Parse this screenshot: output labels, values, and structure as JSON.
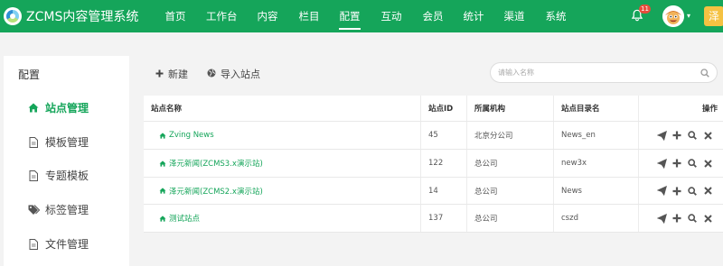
{
  "app": {
    "title": "ZCMS内容管理系统"
  },
  "nav": {
    "items": [
      {
        "label": "首页",
        "active": false
      },
      {
        "label": "工作台",
        "active": false
      },
      {
        "label": "内容",
        "active": false
      },
      {
        "label": "栏目",
        "active": false
      },
      {
        "label": "配置",
        "active": true
      },
      {
        "label": "互动",
        "active": false
      },
      {
        "label": "会员",
        "active": false
      },
      {
        "label": "统计",
        "active": false
      },
      {
        "label": "渠道",
        "active": false
      },
      {
        "label": "系统",
        "active": false
      }
    ]
  },
  "header": {
    "notification_count": "11",
    "user_chip": "泽"
  },
  "sidebar": {
    "title": "配置",
    "items": [
      {
        "label": "站点管理",
        "icon": "home-icon",
        "active": true
      },
      {
        "label": "模板管理",
        "icon": "file-icon",
        "active": false
      },
      {
        "label": "专题模板",
        "icon": "file-icon",
        "active": false
      },
      {
        "label": "标签管理",
        "icon": "tags-icon",
        "active": false
      },
      {
        "label": "文件管理",
        "icon": "file-icon",
        "active": false
      }
    ]
  },
  "toolbar": {
    "new_label": "新建",
    "import_label": "导入站点"
  },
  "search": {
    "placeholder": "请输入名称",
    "value": ""
  },
  "table": {
    "columns": [
      "站点名称",
      "站点ID",
      "所属机构",
      "站点目录名",
      "操作"
    ],
    "rows": [
      {
        "name": "Zving News",
        "id": "45",
        "org": "北京分公司",
        "dir": "News_en"
      },
      {
        "name": "泽元新闻(ZCMS3.x演示站)",
        "id": "122",
        "org": "总公司",
        "dir": "new3x"
      },
      {
        "name": "泽元新闻(ZCMS2.x演示站)",
        "id": "14",
        "org": "总公司",
        "dir": "News"
      },
      {
        "name": "测试站点",
        "id": "137",
        "org": "总公司",
        "dir": "cszd"
      }
    ]
  },
  "colors": {
    "brand": "#15a55a",
    "badge": "#e74c3c",
    "chip": "#f5c242"
  }
}
